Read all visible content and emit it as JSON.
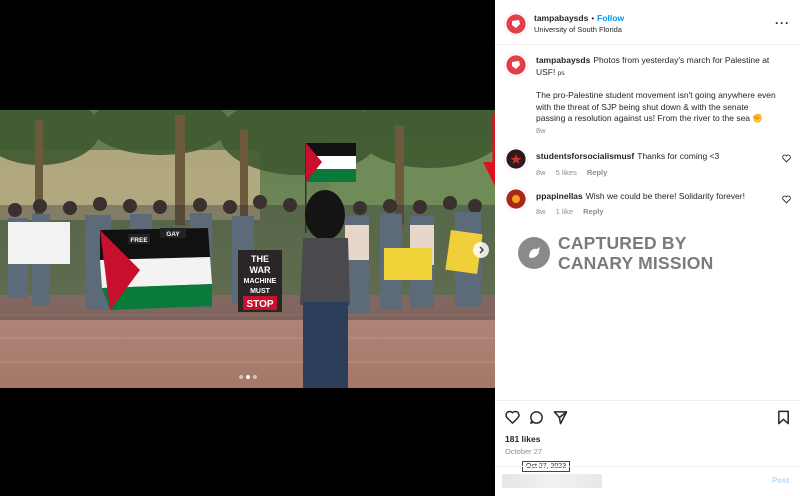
{
  "post": {
    "username": "tampabaysds",
    "bullet": "•",
    "follow_label": "Follow",
    "location": "University of South Florida",
    "more_label": "···",
    "caption_line1": "Photos from yesterday's march for Palestine at USF!",
    "caption_line1_suffix": "ps",
    "caption_line2": "The pro-Palestine student movement isn't going anywhere even with the threat of SJP being shut down & with the senate passing a resolution against us! From the river to the sea ✊",
    "caption_time": "8w",
    "likes": "181 likes",
    "date": "October 27",
    "date_tooltip": "Oct 27, 2023",
    "post_label": "Post"
  },
  "comments": [
    {
      "username": "studentsforsocialismusf",
      "text": "Thanks for coming <3",
      "time": "8w",
      "likes": "5 likes",
      "reply": "Reply"
    },
    {
      "username": "ppapinellas",
      "text": "Wish we could be there! Solidarity forever!",
      "time": "8w",
      "likes": "1 like",
      "reply": "Reply"
    }
  ],
  "watermark": {
    "line1": "CAPTURED BY",
    "line2": "CANARY MISSION"
  },
  "photo_signs": {
    "sign_free": "FREE",
    "sign_war_1": "THE",
    "sign_war_2": "WAR",
    "sign_war_3": "MACHINE",
    "sign_war_4": "MUST",
    "sign_war_5": "STOP",
    "sign_gay": "GAY"
  },
  "colors": {
    "brand_red": "#e23f4b",
    "link_blue": "#0095f6",
    "annotation_red": "#e0121b",
    "flag_red": "#c8102e",
    "flag_green": "#0a7a3a"
  }
}
